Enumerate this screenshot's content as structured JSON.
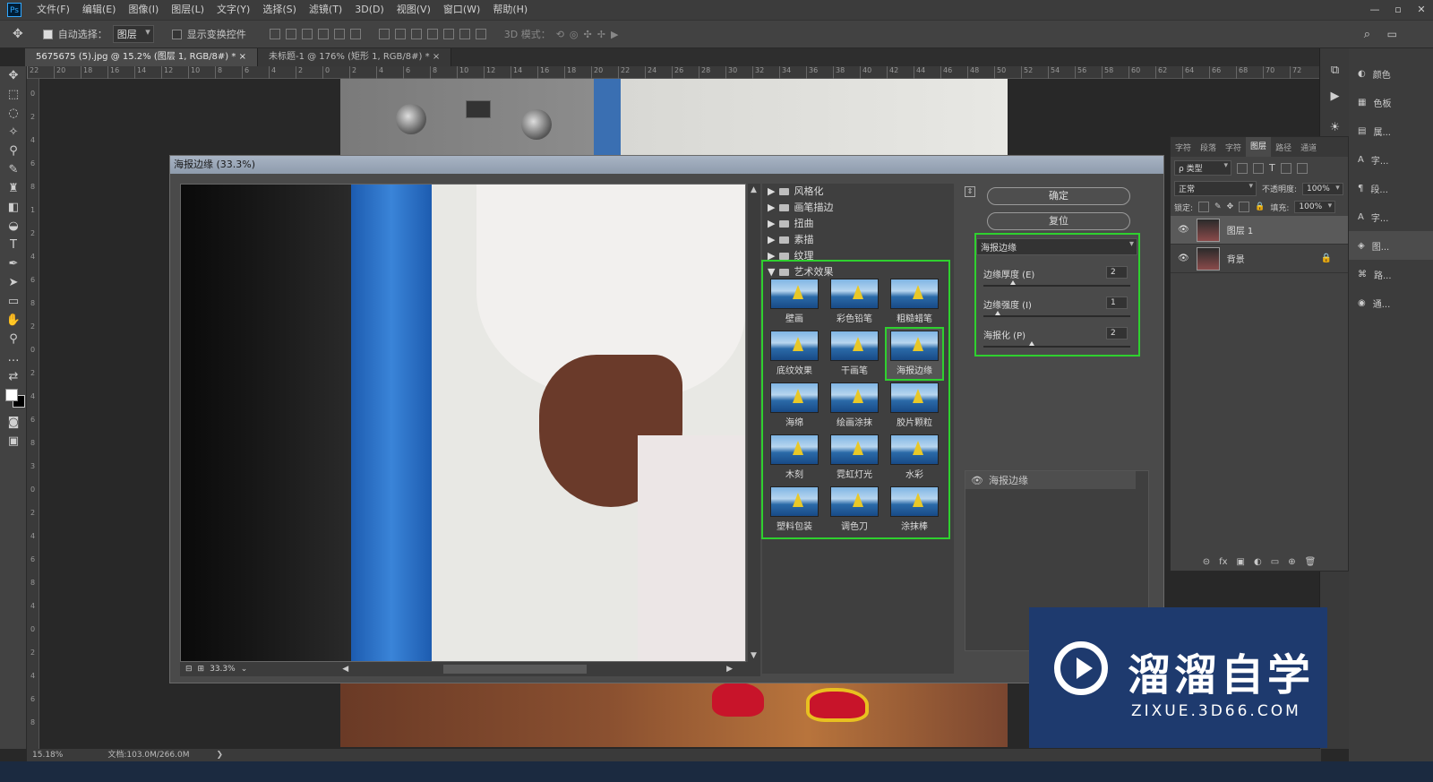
{
  "app": {
    "logo": "Ps"
  },
  "menu": [
    "文件(F)",
    "编辑(E)",
    "图像(I)",
    "图层(L)",
    "文字(Y)",
    "选择(S)",
    "滤镜(T)",
    "3D(D)",
    "视图(V)",
    "窗口(W)",
    "帮助(H)"
  ],
  "window_controls": [
    "—",
    "▫",
    "✕"
  ],
  "options": {
    "auto_select_label": "自动选择：",
    "auto_select_value": "图层",
    "show_transform_label": "显示变换控件",
    "mode_3d_label": "3D 模式："
  },
  "tabs": [
    {
      "label": "5675675 (5).jpg @ 15.2% (图层 1, RGB/8#) *",
      "close": "×"
    },
    {
      "label": "未标题-1 @ 176% (矩形 1, RGB/8#) *",
      "close": "×"
    }
  ],
  "ruler_top": [
    "22",
    "20",
    "18",
    "16",
    "14",
    "12",
    "10",
    "8",
    "6",
    "4",
    "2",
    "0",
    "2",
    "4",
    "6",
    "8",
    "10",
    "12",
    "14",
    "16",
    "18",
    "20",
    "22",
    "24",
    "26",
    "28",
    "30",
    "32",
    "34",
    "36",
    "38",
    "40",
    "42",
    "44",
    "46",
    "48",
    "50",
    "52",
    "54",
    "56",
    "58",
    "60",
    "62",
    "64",
    "66",
    "68",
    "70",
    "72"
  ],
  "ruler_left": [
    "0",
    "2",
    "4",
    "6",
    "8",
    "1",
    "2",
    "4",
    "6",
    "8",
    "2",
    "0",
    "2",
    "4",
    "6",
    "8",
    "3",
    "0",
    "2",
    "4",
    "6",
    "8",
    "4",
    "0",
    "2",
    "4",
    "6",
    "8"
  ],
  "status": {
    "zoom": "15.18%",
    "doc": "文档:103.0M/266.0M",
    "arrow": "❯"
  },
  "dialog": {
    "title": "海报边缘 (33.3%)",
    "zoom": "33.3%",
    "categories": [
      {
        "label": "风格化",
        "arrow": "▶"
      },
      {
        "label": "画笔描边",
        "arrow": "▶"
      },
      {
        "label": "扭曲",
        "arrow": "▶"
      },
      {
        "label": "素描",
        "arrow": "▶"
      },
      {
        "label": "纹理",
        "arrow": "▶"
      },
      {
        "label": "艺术效果",
        "arrow": "▼"
      }
    ],
    "thumbs": [
      "壁画",
      "彩色铅笔",
      "粗糙蜡笔",
      "底纹效果",
      "干画笔",
      "海报边缘",
      "海绵",
      "绘画涂抹",
      "胶片颗粒",
      "木刻",
      "霓虹灯光",
      "水彩",
      "塑料包装",
      "调色刀",
      "涂抹棒"
    ],
    "selected_thumb": "海报边缘",
    "ok": "确定",
    "reset": "复位",
    "filter_select": "海报边缘",
    "params": [
      {
        "label": "边缘厚度 (E)",
        "value": "2",
        "pos": 0.2
      },
      {
        "label": "边缘强度 (I)",
        "value": "1",
        "pos": 0.1
      },
      {
        "label": "海报化 (P)",
        "value": "2",
        "pos": 0.33
      }
    ],
    "layer_name": "海报边缘"
  },
  "right_icons": [
    {
      "name": "颜色",
      "icon": "◐"
    },
    {
      "name": "色板",
      "icon": "▦"
    },
    {
      "name": "属...",
      "icon": "▤"
    },
    {
      "name": "字...",
      "icon": "A"
    },
    {
      "name": "段...",
      "icon": "¶"
    },
    {
      "name": "字...",
      "icon": "A"
    },
    {
      "name": "图...",
      "icon": "◈"
    },
    {
      "name": "路...",
      "icon": "⌘"
    },
    {
      "name": "通...",
      "icon": "◉"
    }
  ],
  "layers_panel": {
    "tabs": [
      "字符",
      "段落",
      "字符",
      "图层",
      "路径",
      "通道"
    ],
    "kind": "ρ 类型",
    "blend": "正常",
    "opacity_label": "不透明度:",
    "opacity": "100%",
    "lock_label": "锁定:",
    "fill_label": "填充:",
    "fill": "100%",
    "layers": [
      {
        "name": "图层 1",
        "active": true
      },
      {
        "name": "背景",
        "active": false
      }
    ],
    "footer_icons": [
      "⊝",
      "fx",
      "▣",
      "◐",
      "▭",
      "⊕",
      "🗑"
    ]
  },
  "watermark": {
    "brand": "溜溜自学",
    "url": "ZIXUE.3D66.COM"
  }
}
